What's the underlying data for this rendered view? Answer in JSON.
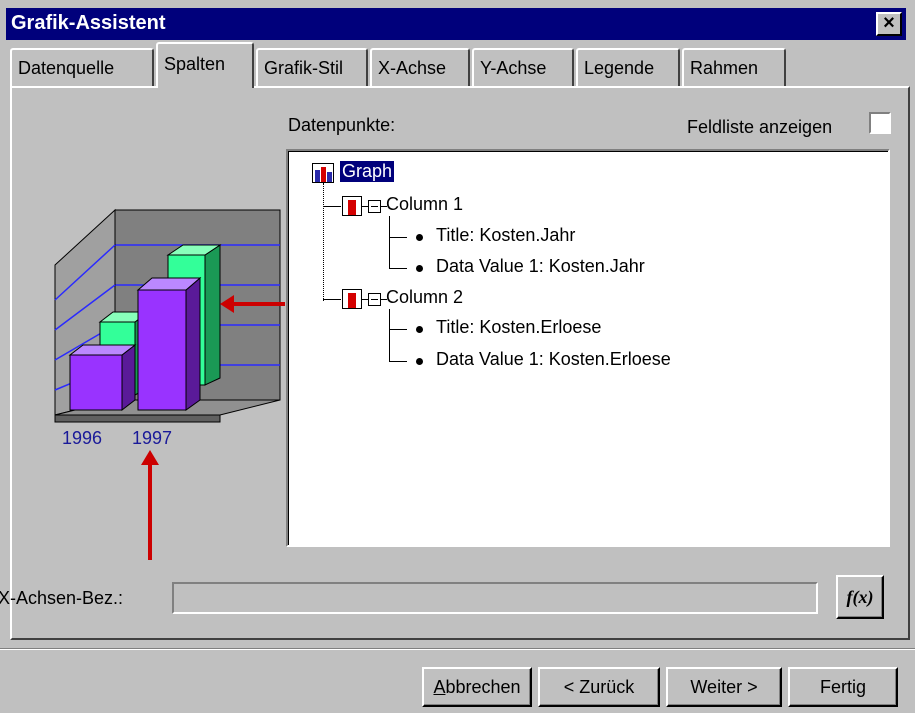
{
  "window": {
    "title": "Grafik-Assistent",
    "close_label": "×"
  },
  "tabs": [
    {
      "label": "Datenquelle"
    },
    {
      "label": "Spalten",
      "active": true
    },
    {
      "label": "Grafik-Stil"
    },
    {
      "label": "X-Achse"
    },
    {
      "label": "Y-Achse"
    },
    {
      "label": "Legende"
    },
    {
      "label": "Rahmen"
    }
  ],
  "panel": {
    "datapoints_label": "Datenpunkte:",
    "fieldlist_label": "Feldliste anzeigen",
    "fieldlist_checked": false,
    "preview_labels": [
      "1996",
      "1997"
    ],
    "xaxis_label": "X-Achsen-Bez.:",
    "xaxis_value": "",
    "fx_label": "f(x)"
  },
  "tree": {
    "root": "Graph",
    "columns": [
      {
        "label": "Column 1",
        "title": "Title:  Kosten.Jahr",
        "value": "Data Value 1:  Kosten.Jahr"
      },
      {
        "label": "Column 2",
        "title": "Title:  Kosten.Erloese",
        "value": "Data Value 1:  Kosten.Erloese"
      }
    ]
  },
  "buttons": {
    "cancel_accel": "A",
    "cancel_rest": "bbrechen",
    "back": "< Zurück",
    "next": "Weiter >",
    "finish": "Fertig"
  },
  "colors": {
    "titlebar": "#00007b",
    "face": "#c0c0c0",
    "arrow": "#cc0000",
    "bar_purple": "#8a2be2",
    "bar_green": "#22bb66"
  }
}
